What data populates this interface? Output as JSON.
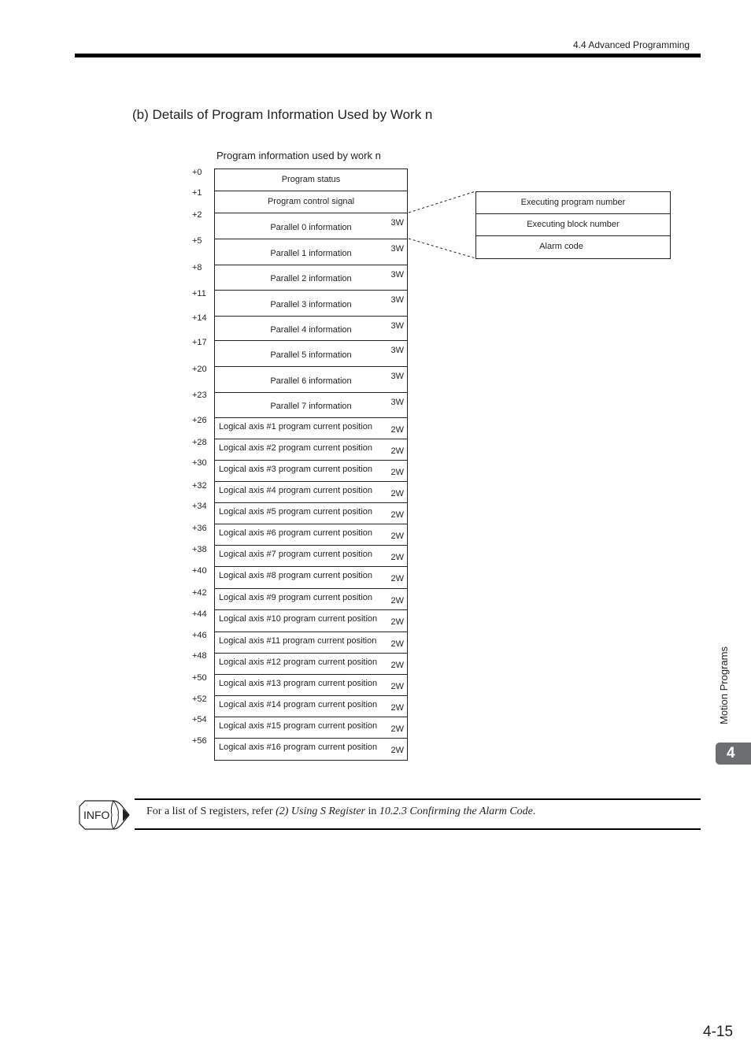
{
  "header": {
    "section": "4.4  Advanced Programming"
  },
  "section_title": "(b) Details of Program Information Used by Work n",
  "table": {
    "caption": "Program information used by work n",
    "rows": [
      {
        "offset": "+0",
        "label": "Program status",
        "size": ""
      },
      {
        "offset": "+1",
        "label": "Program control signal",
        "size": ""
      },
      {
        "offset": "+2",
        "label": "Parallel 0 information",
        "size": "3W"
      },
      {
        "offset": "+5",
        "label": "Parallel 1 information",
        "size": "3W"
      },
      {
        "offset": "+8",
        "label": "Parallel 2 information",
        "size": "3W"
      },
      {
        "offset": "+11",
        "label": "Parallel 3 information",
        "size": "3W"
      },
      {
        "offset": "+14",
        "label": "Parallel 4 information",
        "size": "3W"
      },
      {
        "offset": "+17",
        "label": "Parallel 5 information",
        "size": "3W"
      },
      {
        "offset": "+20",
        "label": "Parallel 6 information",
        "size": "3W"
      },
      {
        "offset": "+23",
        "label": "Parallel 7 information",
        "size": "3W"
      },
      {
        "offset": "+26",
        "label": "Logical axis #1 program current position",
        "size": "2W"
      },
      {
        "offset": "+28",
        "label": "Logical axis #2 program current position",
        "size": "2W"
      },
      {
        "offset": "+30",
        "label": "Logical axis #3 program current position",
        "size": "2W"
      },
      {
        "offset": "+32",
        "label": "Logical axis #4 program current position",
        "size": "2W"
      },
      {
        "offset": "+34",
        "label": "Logical axis #5 program current position",
        "size": "2W"
      },
      {
        "offset": "+36",
        "label": "Logical axis #6 program current position",
        "size": "2W"
      },
      {
        "offset": "+38",
        "label": "Logical axis #7 program current position",
        "size": "2W"
      },
      {
        "offset": "+40",
        "label": "Logical axis #8 program current position",
        "size": "2W"
      },
      {
        "offset": "+42",
        "label": "Logical axis #9 program current position",
        "size": "2W"
      },
      {
        "offset": "+44",
        "label": "Logical axis #10 program current position",
        "size": "2W"
      },
      {
        "offset": "+46",
        "label": "Logical axis #11 program current position",
        "size": "2W"
      },
      {
        "offset": "+48",
        "label": "Logical axis #12 program current position",
        "size": "2W"
      },
      {
        "offset": "+50",
        "label": "Logical axis #13 program current position",
        "size": "2W"
      },
      {
        "offset": "+52",
        "label": "Logical axis #14 program current position",
        "size": "2W"
      },
      {
        "offset": "+54",
        "label": "Logical axis #15 program current position",
        "size": "2W"
      },
      {
        "offset": "+56",
        "label": "Logical axis #16 program current position",
        "size": "2W"
      }
    ]
  },
  "parallel_detail": {
    "rows": [
      {
        "label": "Executing program number"
      },
      {
        "label": "Executing block number"
      },
      {
        "label": "Alarm code"
      }
    ]
  },
  "info_note": {
    "icon": "info-pencil-icon",
    "icon_text": "INFO",
    "text_before": "For a list of S registers, refer ",
    "link1": "(2) Using S Register",
    "text_middle": " in ",
    "link2": "10.2.3 Confirming the Alarm Code",
    "text_after": "."
  },
  "side_tab": {
    "chapter_label": "Motion Programs",
    "chapter_number": "4"
  },
  "page_number": "4-15"
}
